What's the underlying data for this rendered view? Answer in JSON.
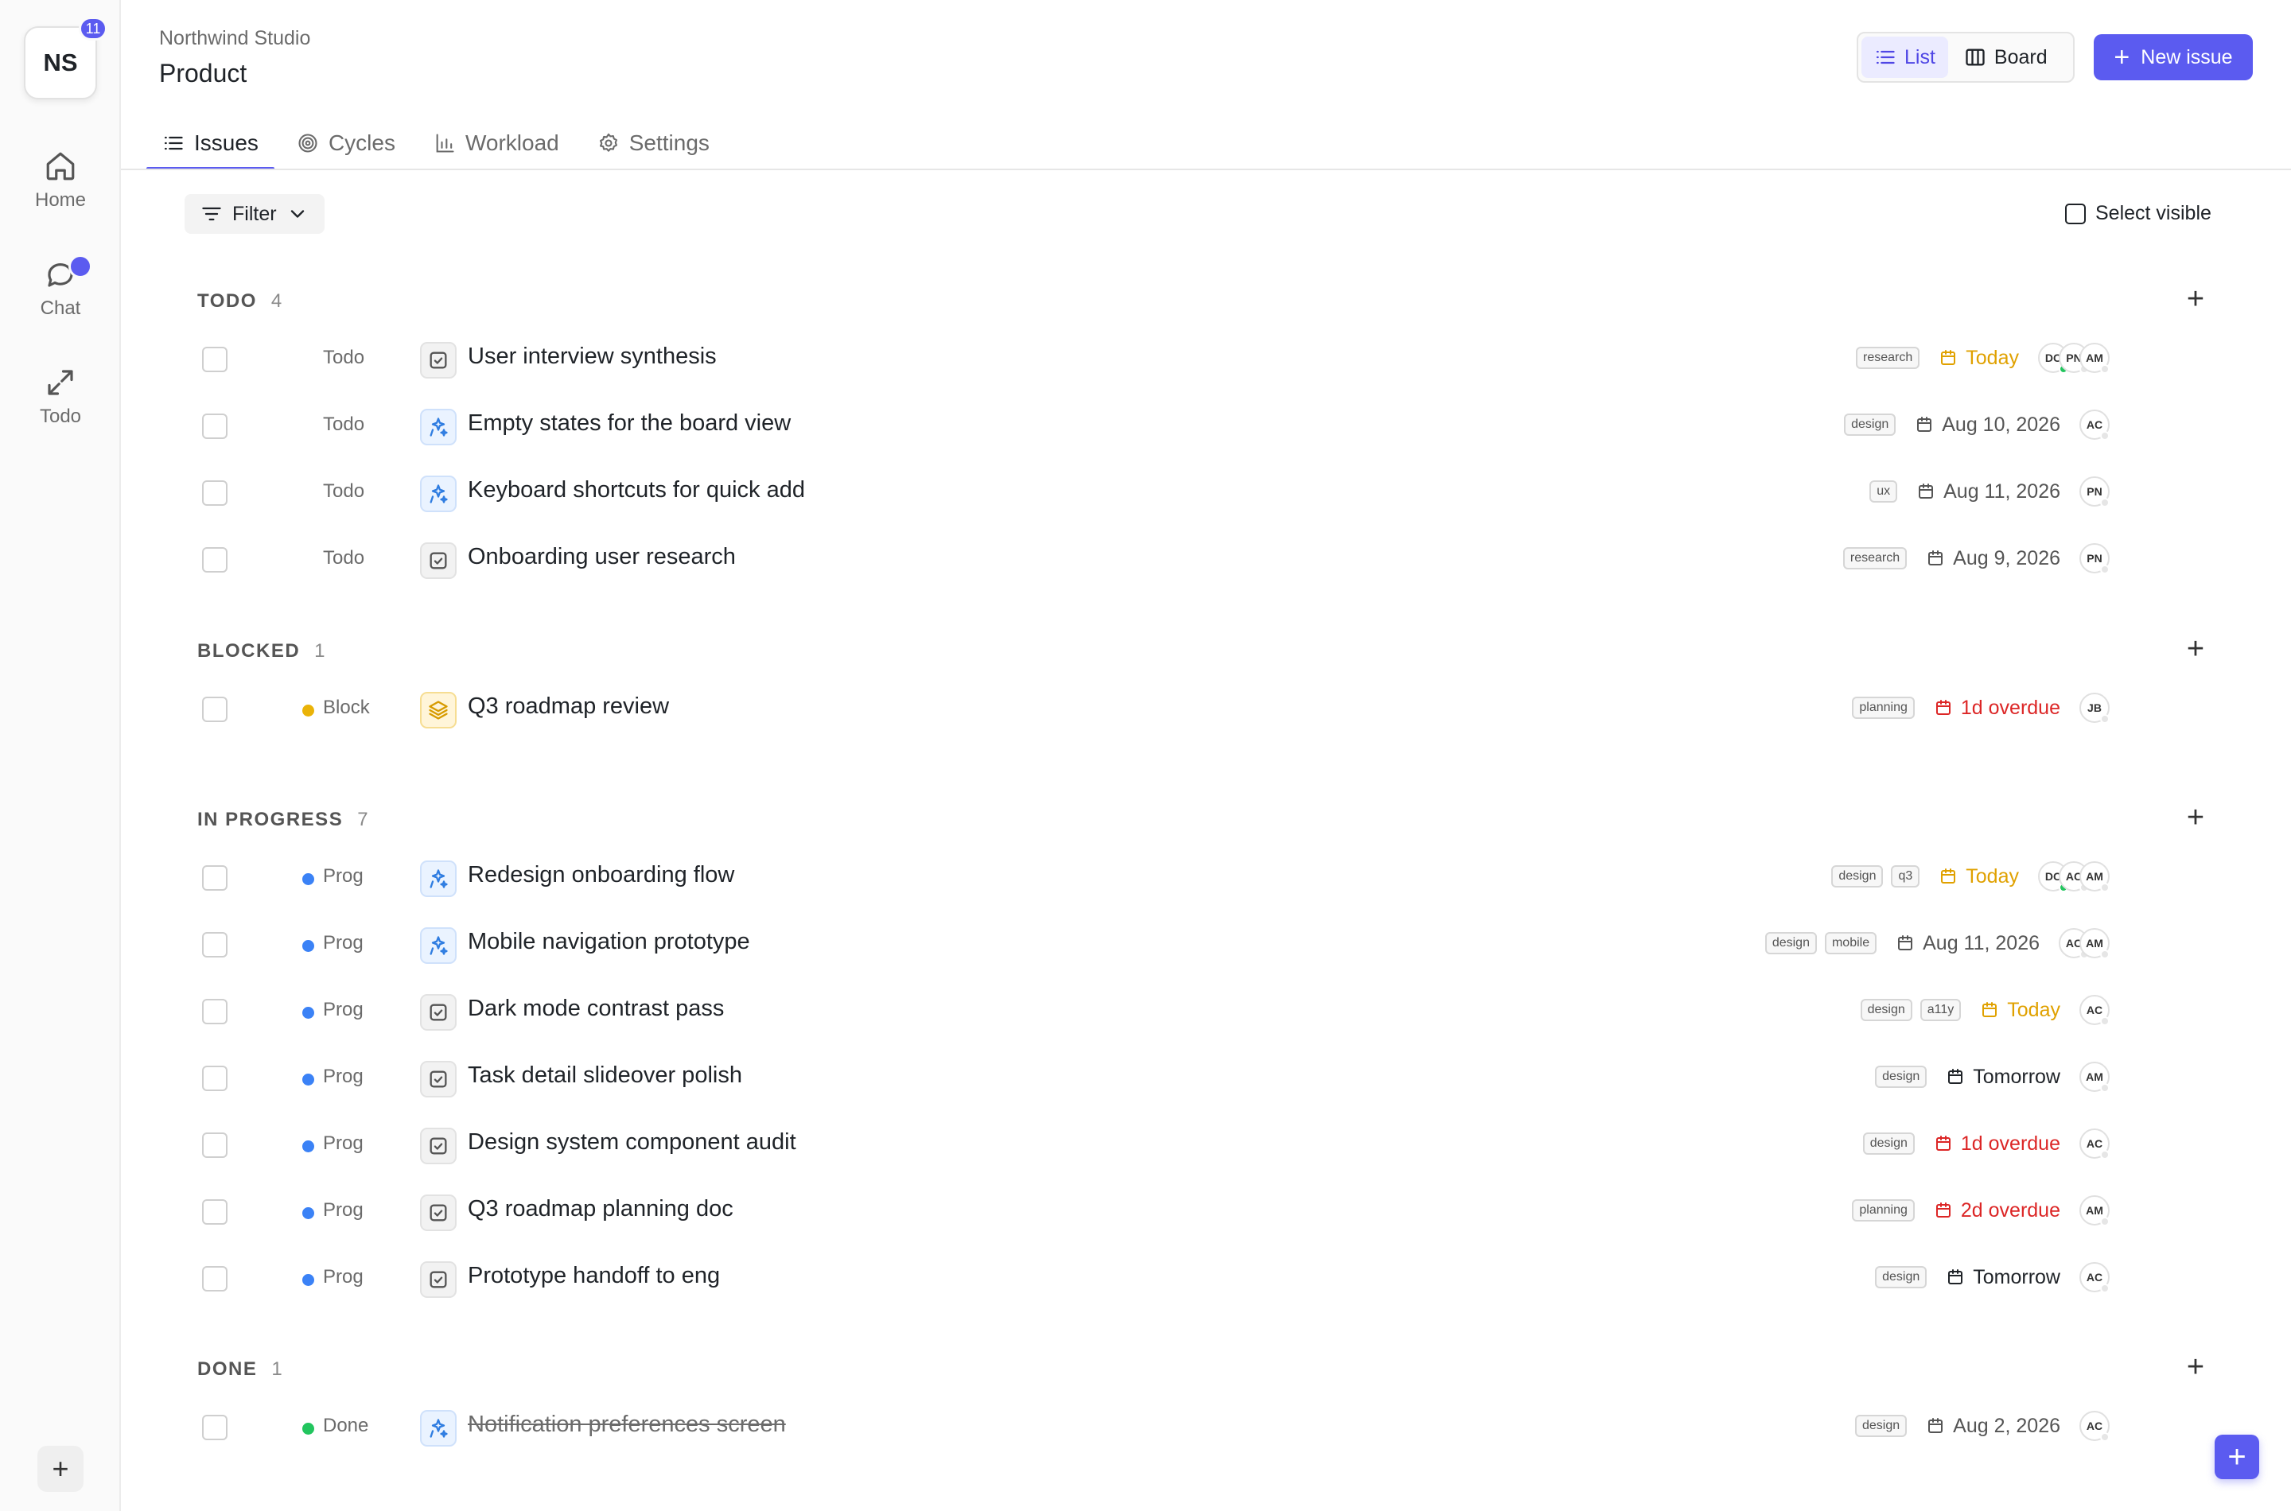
{
  "workspace": {
    "initials": "NS",
    "badge": "11"
  },
  "rail": {
    "items": [
      {
        "label": "Home",
        "icon": "home-icon"
      },
      {
        "label": "Chat",
        "icon": "chat-icon"
      },
      {
        "label": "Todo",
        "icon": "expand-icon"
      }
    ]
  },
  "header": {
    "org": "Northwind Studio",
    "project": "Product"
  },
  "view_toggle": {
    "list": "List",
    "board": "Board",
    "active": "List"
  },
  "new_issue": "New issue",
  "tabs": [
    {
      "label": "Issues",
      "icon": "list-icon",
      "active": true
    },
    {
      "label": "Cycles",
      "icon": "target-icon",
      "active": false
    },
    {
      "label": "Workload",
      "icon": "bar-chart-icon",
      "active": false
    },
    {
      "label": "Settings",
      "icon": "gear-icon",
      "active": false
    }
  ],
  "toolbar": {
    "filter": "Filter",
    "select_visible": "Select visible"
  },
  "colors": {
    "accent": "#5b5bf0",
    "blocked": "#eab308",
    "progress": "#3b82f6",
    "done": "#22c55e",
    "today": "#e0a100",
    "overdue": "#dc2626"
  },
  "groups": [
    {
      "name": "TODO",
      "count": "4",
      "rows": [
        {
          "status": "Todo",
          "dot": "none",
          "type": "task",
          "title": "User interview synthesis",
          "labels": [
            "research"
          ],
          "date": "Today",
          "date_kind": "today",
          "assignees": [
            "DC",
            "PN",
            "AM"
          ],
          "online": [
            true,
            false,
            false
          ]
        },
        {
          "status": "Todo",
          "dot": "none",
          "type": "feature",
          "title": "Empty states for the board view",
          "labels": [
            "design"
          ],
          "date": "Aug 10, 2026",
          "date_kind": "neutral",
          "assignees": [
            "AC"
          ],
          "online": [
            false
          ]
        },
        {
          "status": "Todo",
          "dot": "none",
          "type": "feature",
          "title": "Keyboard shortcuts for quick add",
          "labels": [
            "ux"
          ],
          "date": "Aug 11, 2026",
          "date_kind": "neutral",
          "assignees": [
            "PN"
          ],
          "online": [
            false
          ]
        },
        {
          "status": "Todo",
          "dot": "none",
          "type": "task",
          "title": "Onboarding user research",
          "labels": [
            "research"
          ],
          "date": "Aug 9, 2026",
          "date_kind": "neutral",
          "assignees": [
            "PN"
          ],
          "online": [
            false
          ]
        }
      ]
    },
    {
      "name": "BLOCKED",
      "count": "1",
      "rows": [
        {
          "status": "Block",
          "dot": "blocked",
          "type": "epic",
          "title": "Q3 roadmap review",
          "labels": [
            "planning"
          ],
          "date": "1d overdue",
          "date_kind": "overdue",
          "assignees": [
            "JB"
          ],
          "online": [
            false
          ]
        }
      ]
    },
    {
      "name": "IN PROGRESS",
      "count": "7",
      "rows": [
        {
          "status": "Prog",
          "dot": "progress",
          "type": "feature",
          "title": "Redesign onboarding flow",
          "labels": [
            "design",
            "q3"
          ],
          "date": "Today",
          "date_kind": "today",
          "assignees": [
            "DC",
            "AC",
            "AM"
          ],
          "online": [
            true,
            false,
            false
          ]
        },
        {
          "status": "Prog",
          "dot": "progress",
          "type": "feature",
          "title": "Mobile navigation prototype",
          "labels": [
            "design",
            "mobile"
          ],
          "date": "Aug 11, 2026",
          "date_kind": "neutral",
          "assignees": [
            "AC",
            "AM"
          ],
          "online": [
            false,
            false
          ]
        },
        {
          "status": "Prog",
          "dot": "progress",
          "type": "task",
          "title": "Dark mode contrast pass",
          "labels": [
            "design",
            "a11y"
          ],
          "date": "Today",
          "date_kind": "today",
          "assignees": [
            "AC"
          ],
          "online": [
            false
          ]
        },
        {
          "status": "Prog",
          "dot": "progress",
          "type": "task",
          "title": "Task detail slideover polish",
          "labels": [
            "design"
          ],
          "date": "Tomorrow",
          "date_kind": "dark",
          "assignees": [
            "AM"
          ],
          "online": [
            false
          ]
        },
        {
          "status": "Prog",
          "dot": "progress",
          "type": "task",
          "title": "Design system component audit",
          "labels": [
            "design"
          ],
          "date": "1d overdue",
          "date_kind": "overdue",
          "assignees": [
            "AC"
          ],
          "online": [
            false
          ]
        },
        {
          "status": "Prog",
          "dot": "progress",
          "type": "task",
          "title": "Q3 roadmap planning doc",
          "labels": [
            "planning"
          ],
          "date": "2d overdue",
          "date_kind": "overdue",
          "assignees": [
            "AM"
          ],
          "online": [
            false
          ]
        },
        {
          "status": "Prog",
          "dot": "progress",
          "type": "task",
          "title": "Prototype handoff to eng",
          "labels": [
            "design"
          ],
          "date": "Tomorrow",
          "date_kind": "dark",
          "assignees": [
            "AC"
          ],
          "online": [
            false
          ]
        }
      ]
    },
    {
      "name": "DONE",
      "count": "1",
      "rows": [
        {
          "status": "Done",
          "dot": "done",
          "type": "feature",
          "title": "Notification preferences screen",
          "labels": [
            "design"
          ],
          "date": "Aug 2, 2026",
          "date_kind": "neutral",
          "assignees": [
            "AC"
          ],
          "online": [
            false
          ],
          "completed": true
        }
      ]
    }
  ]
}
